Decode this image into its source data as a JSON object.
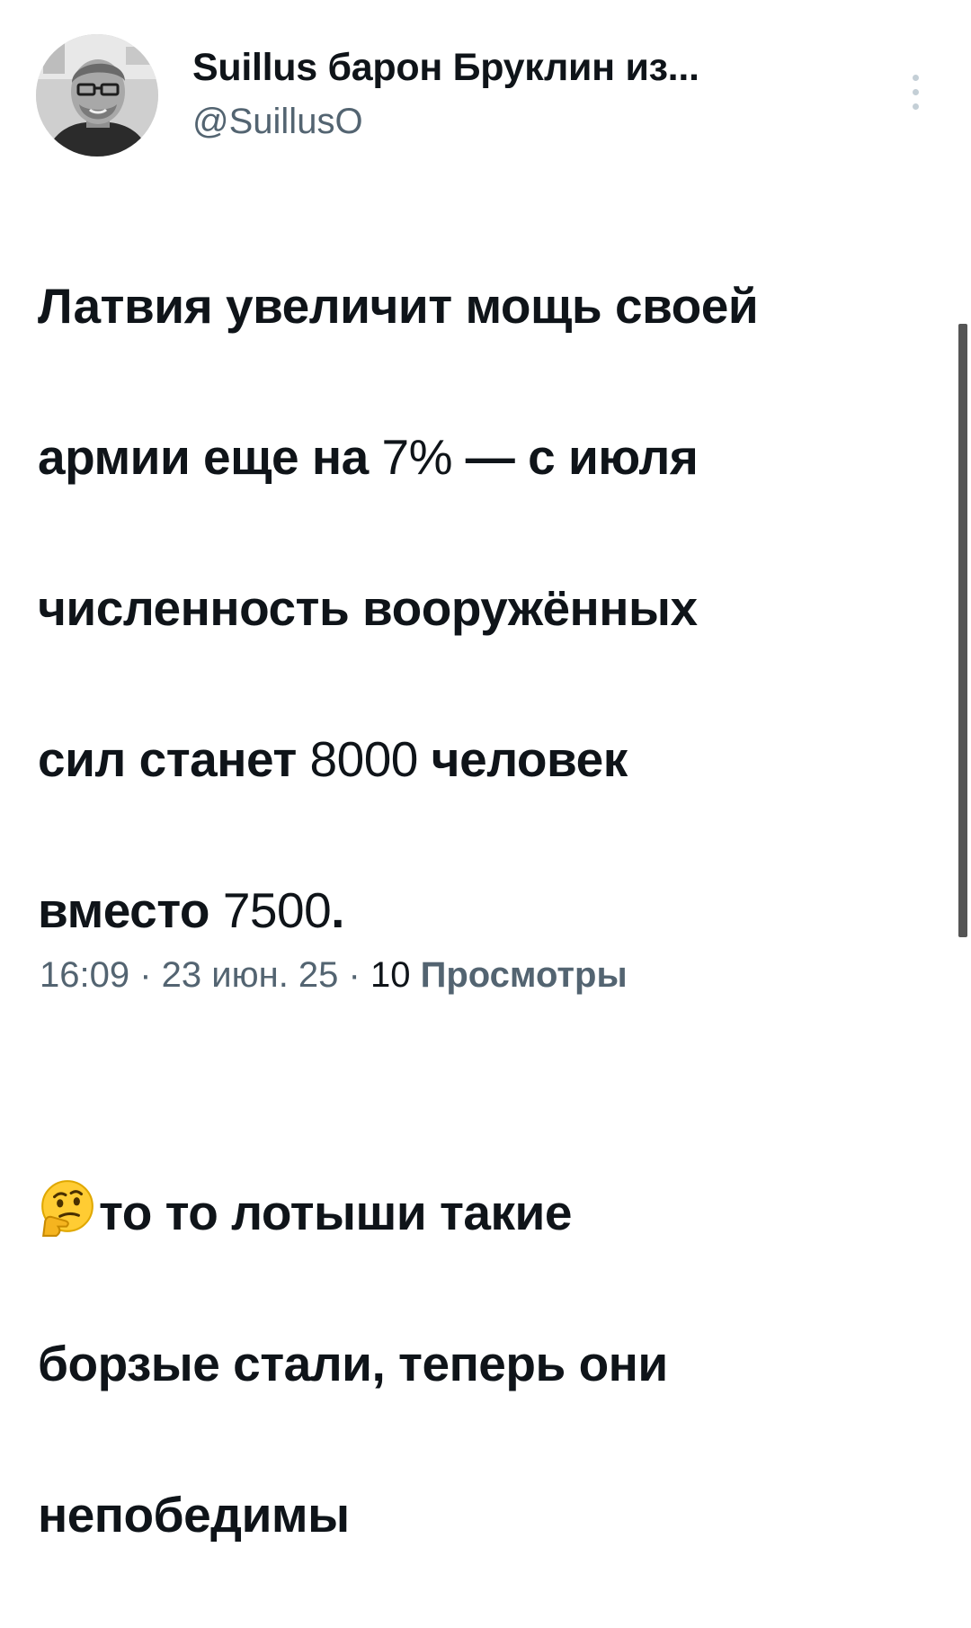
{
  "author": {
    "display_name": "Suillus барон Бруклин из...",
    "handle": "@SuillusO",
    "avatar_icon": "profile-photo"
  },
  "menu": {
    "icon": "more-vertical-icon"
  },
  "tweet": {
    "paragraph1": [
      {
        "text": "Латвия увеличит мощь своей"
      },
      {
        "pre": "армии еще на ",
        "num": "7%",
        "post": " — с июля"
      },
      {
        "text": "численность вооружённых"
      },
      {
        "pre": "сил станет ",
        "num": "8000",
        "post": " человек"
      },
      {
        "pre": "вместо ",
        "num": "7500",
        "post": "."
      }
    ],
    "paragraph2": {
      "emoji_icon": "thinking-face-icon",
      "line1": "то то лотыши такие",
      "line2": "борзые стали, теперь они",
      "line3": "непобедимы"
    }
  },
  "meta": {
    "time": "16:09",
    "separator1": " · ",
    "date": "23 июн. 25",
    "separator2": " · ",
    "views_count": "10",
    "views_label": "Просмотры"
  },
  "colors": {
    "text": "#0f1419",
    "secondary": "#536471",
    "scrollbar": "#555555"
  }
}
